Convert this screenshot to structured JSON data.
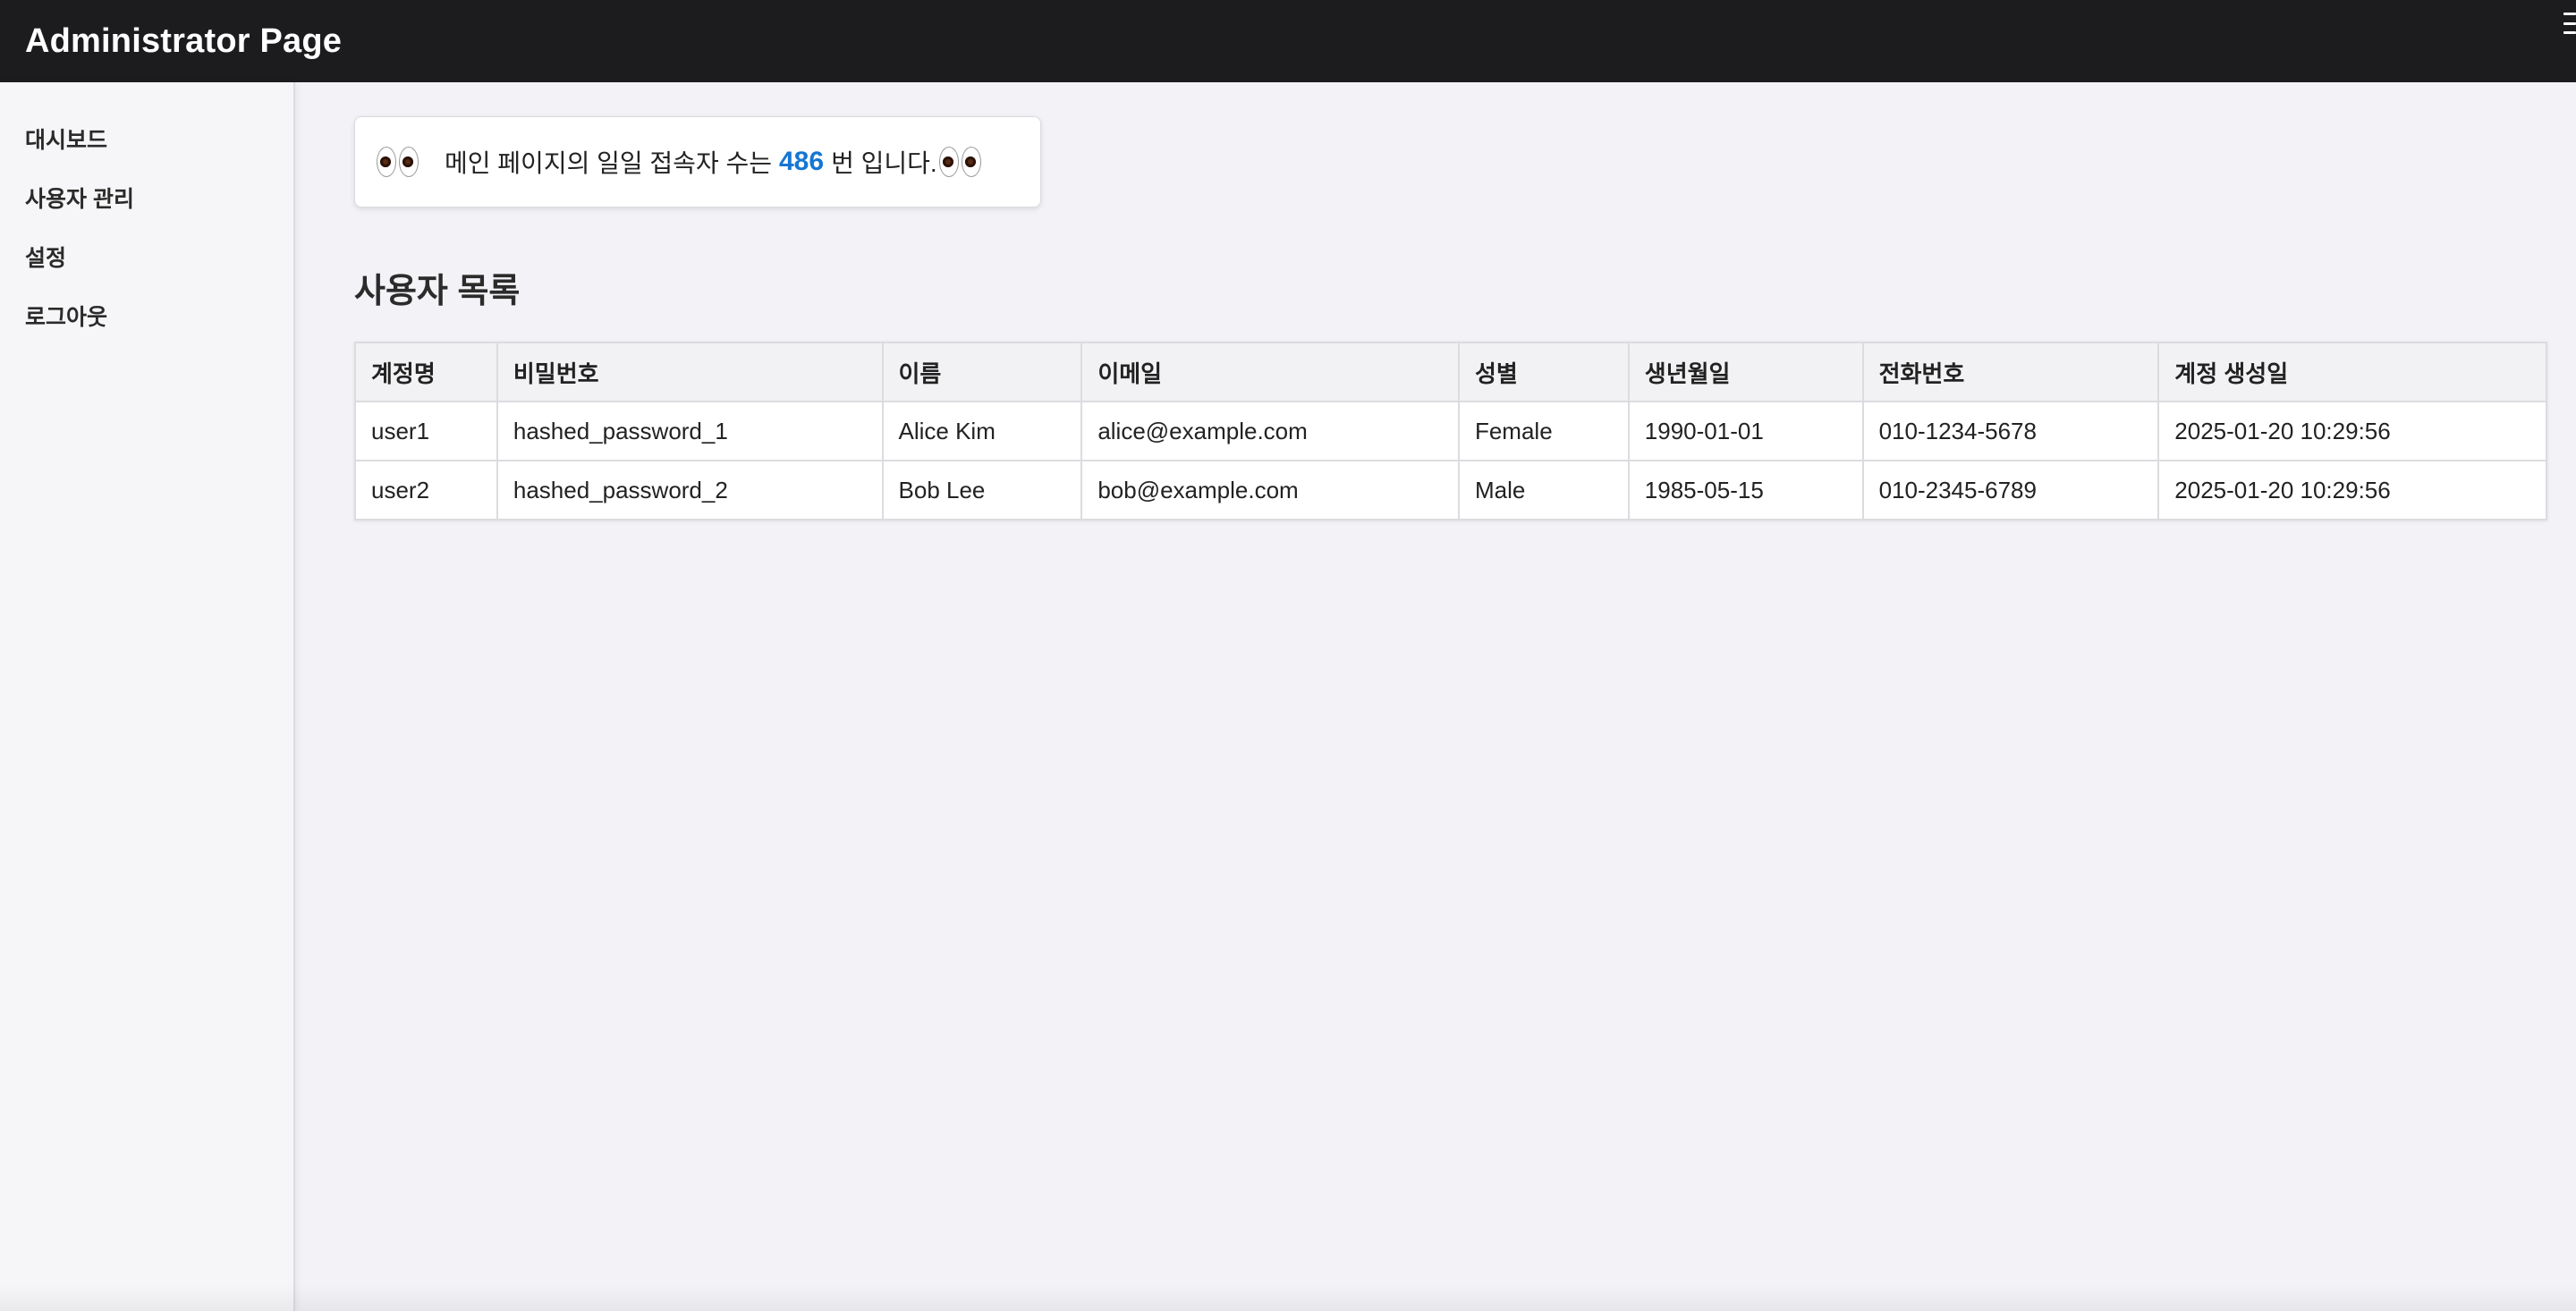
{
  "header": {
    "title": "Administrator Page"
  },
  "sidebar": {
    "items": [
      {
        "label": "대시보드"
      },
      {
        "label": "사용자 관리"
      },
      {
        "label": "설정"
      },
      {
        "label": "로그아웃"
      }
    ]
  },
  "visits": {
    "prefix": "메인 페이지의 일일 접속자 수는",
    "count": "486",
    "suffix": "번 입니다."
  },
  "users_section": {
    "title": "사용자 목록",
    "columns": [
      "계정명",
      "비밀번호",
      "이름",
      "이메일",
      "성별",
      "생년월일",
      "전화번호",
      "계정 생성일"
    ],
    "rows": [
      [
        "user1",
        "hashed_password_1",
        "Alice Kim",
        "alice@example.com",
        "Female",
        "1990-01-01",
        "010-1234-5678",
        "2025-01-20 10:29:56"
      ],
      [
        "user2",
        "hashed_password_2",
        "Bob Lee",
        "bob@example.com",
        "Male",
        "1985-05-15",
        "010-2345-6789",
        "2025-01-20 10:29:56"
      ]
    ]
  },
  "icons": {
    "menu": "menu-icon",
    "eyes": "eyes-icon",
    "accent": "#1576d2"
  }
}
